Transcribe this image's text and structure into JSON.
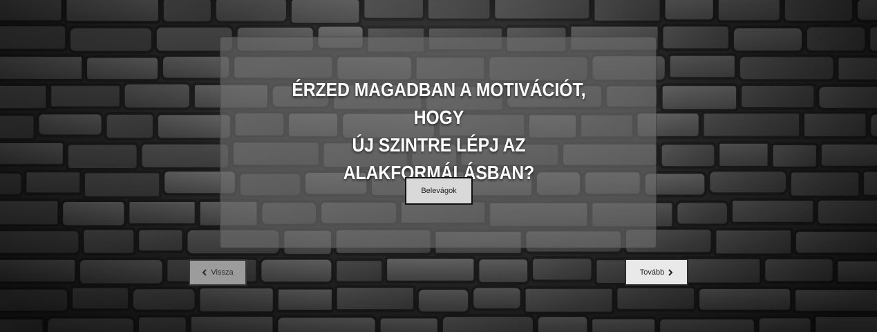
{
  "page": {
    "background": "stone-wall",
    "panel_color": "#6e6e6e"
  },
  "question": {
    "line1": "ÉRZED MAGADBAN A MOTIVÁCIÓT, HOGY",
    "line2": "ÚJ SZINTRE LÉPJ AZ",
    "line3": "ALAKFORMÁLÁSBAN?"
  },
  "cta": {
    "label": "Belevágok"
  },
  "nav": {
    "prev_label": "Vissza",
    "prev_icon": "chevron-left-icon",
    "next_label": "Tovább",
    "next_icon": "chevron-right-icon"
  }
}
